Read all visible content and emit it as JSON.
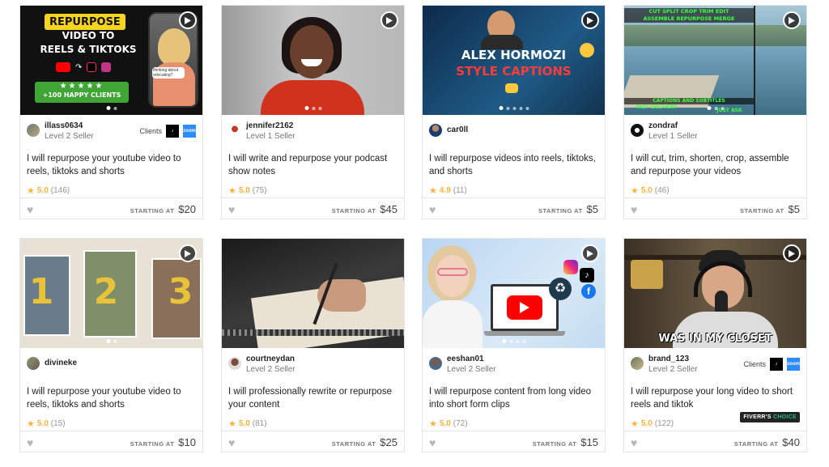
{
  "starting_label": "STARTING AT",
  "clients_label": "Clients",
  "cards": [
    {
      "seller": "illass0634",
      "level": "Level 2 Seller",
      "has_clients": true,
      "title": "I will repurpose your youtube video to reels, tiktoks and shorts",
      "rating": "5.0",
      "reviews": "(146)",
      "price": "$20",
      "thumb_text": {
        "line1": "REPURPOSE",
        "line2": "VIDEO TO",
        "line3": "REELS & TIKTOKS",
        "line4": "+100 HAPPY CLIENTS",
        "bubble": "thinking about relocating?"
      }
    },
    {
      "seller": "jennifer2162",
      "level": "Level 1 Seller",
      "has_clients": false,
      "title": "I will write and repurpose your podcast show notes",
      "rating": "5.0",
      "reviews": "(75)",
      "price": "$45"
    },
    {
      "seller": "car0ll",
      "level": "",
      "has_clients": false,
      "title": "I will repurpose videos into reels, tiktoks, and shorts",
      "rating": "4.9",
      "reviews": "(11)",
      "price": "$5",
      "thumb_text": {
        "line1": "ALEX HORMOZI",
        "line2": "STYLE CAPTIONS"
      }
    },
    {
      "seller": "zondraf",
      "level": "Level 1 Seller",
      "has_clients": false,
      "title": "I will cut, trim, shorten, crop, assemble and repurpose your videos",
      "rating": "5.0",
      "reviews": "(46)",
      "price": "$5",
      "thumb_text": {
        "line1": "CUT  SPLIT  CROP  TRIM  EDIT",
        "line2": "ASSEMBLE  REPURPOSE  MERGE",
        "line3": "FAST DELIVERY",
        "line4": "CAPTIONS AND SUBTITLES",
        "line5": "JUST ASK"
      }
    },
    {
      "seller": "divineke",
      "level": "",
      "has_clients": false,
      "title": "I will repurpose your youtube video to reels, tiktoks and shorts",
      "rating": "5.0",
      "reviews": "(15)",
      "price": "$10",
      "thumb_text": {
        "n1": "1",
        "n2": "2",
        "n3": "3"
      }
    },
    {
      "seller": "courtneydan",
      "level": "Level 2 Seller",
      "has_clients": false,
      "title": "I will professionally rewrite or repurpose your content",
      "rating": "5.0",
      "reviews": "(81)",
      "price": "$25"
    },
    {
      "seller": "eeshan01",
      "level": "Level 2 Seller",
      "has_clients": false,
      "title": "I will repurpose content from long video into short form clips",
      "rating": "5.0",
      "reviews": "(72)",
      "price": "$15"
    },
    {
      "seller": "brand_123",
      "level": "Level 2 Seller",
      "has_clients": true,
      "title": "I will repurpose your long video to short reels and tiktok",
      "rating": "5.0",
      "reviews": "(122)",
      "price": "$40",
      "badge": {
        "text": "FIVERR'S",
        "accent": "CHOICE"
      },
      "thumb_text": {
        "line1": "WAS IN MY CLOSET"
      }
    }
  ],
  "colors": {
    "star": "#ffb33e",
    "accent": "#1dbf73",
    "border": "#e4e5e7"
  }
}
